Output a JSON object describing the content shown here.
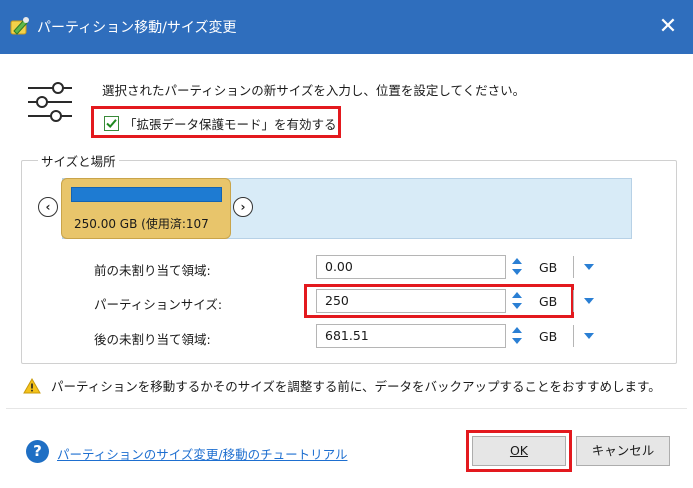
{
  "window": {
    "title": "パーティション移動/サイズ変更",
    "close_label": "✕"
  },
  "header": {
    "instruction": "選択されたパーティションの新サイズを入力し、位置を設定してください。",
    "checkbox_label": "「拡張データ保護モード」を有効する",
    "checkbox_checked": true
  },
  "group": {
    "title": "サイズと場所",
    "partition_text": "250.00 GB (使用済:107"
  },
  "fields": [
    {
      "label": "前の未割り当て領域:",
      "value": "0.00",
      "unit": "GB"
    },
    {
      "label": "パーティションサイズ:",
      "value": "250",
      "unit": "GB"
    },
    {
      "label": "後の未割り当て領域:",
      "value": "681.51",
      "unit": "GB"
    }
  ],
  "warning": "パーティションを移動するかそのサイズを調整する前に、データをバックアップすることをおすすめします。",
  "footer": {
    "help_icon": "?",
    "help_link": "パーティションのサイズ変更/移動のチュートリアル",
    "ok_label": "OK",
    "cancel_label": "キャンセル"
  },
  "colors": {
    "titlebar": "#2f6ebd",
    "highlight": "#e3191e",
    "partition": "#e8c56b",
    "partition_bar": "#1e7bd2",
    "disk_map": "#d8ebf7"
  }
}
